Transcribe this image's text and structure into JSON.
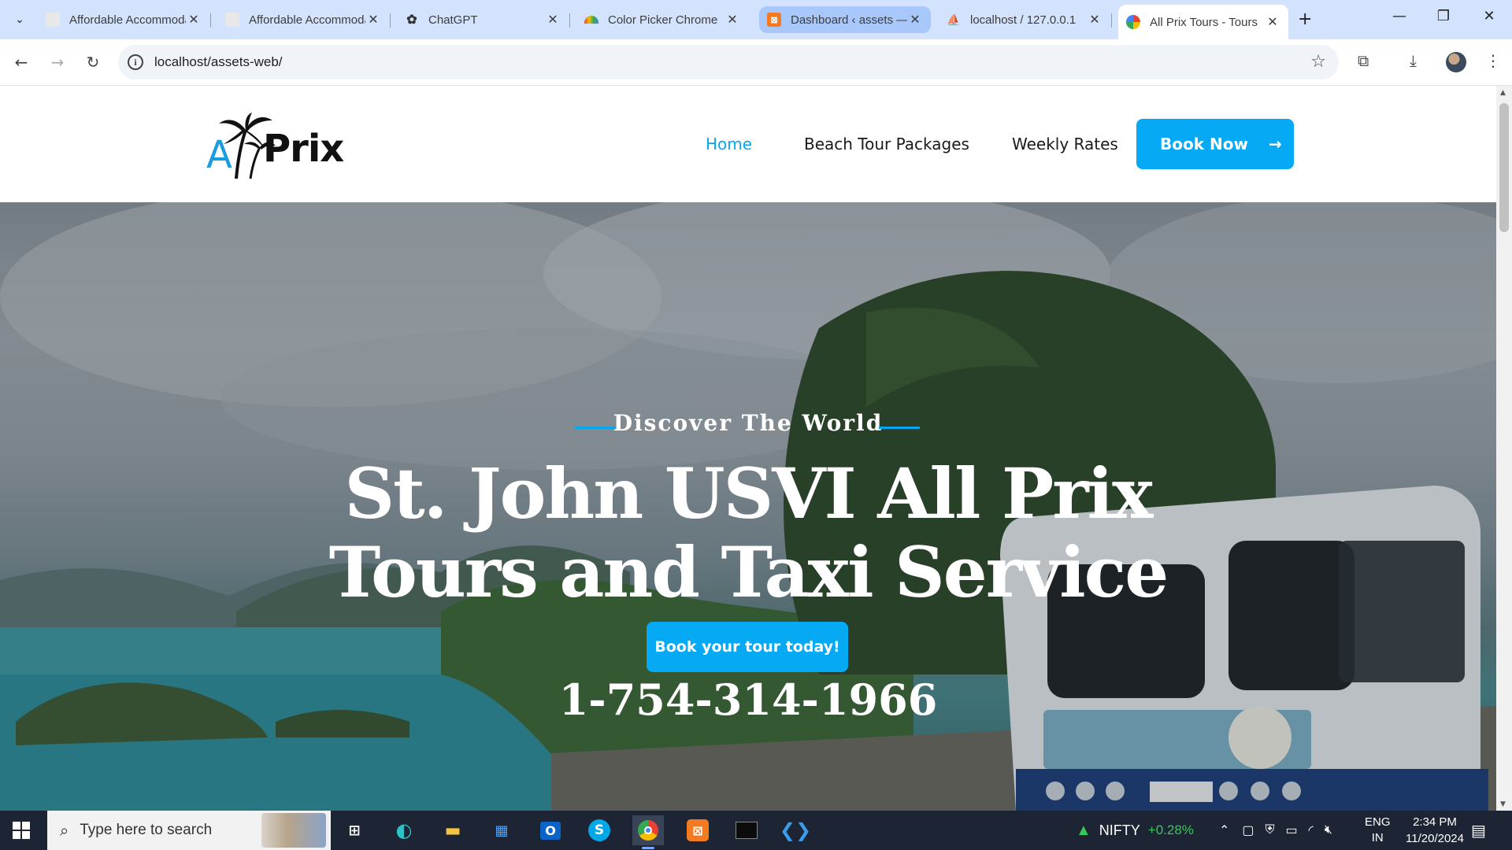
{
  "browser": {
    "tabs": [
      {
        "title": "Affordable Accommodation",
        "favicon": "page-thumbnail-icon"
      },
      {
        "title": "Affordable Accommodation",
        "favicon": "page-thumbnail-icon"
      },
      {
        "title": "ChatGPT",
        "favicon": "chatgpt-icon"
      },
      {
        "title": "Color Picker Chrome",
        "favicon": "rainbow-icon"
      },
      {
        "title": "Dashboard ‹ assets —",
        "favicon": "xampp-icon"
      },
      {
        "title": "localhost / 127.0.0.1",
        "favicon": "phpmyadmin-icon"
      },
      {
        "title": "All Prix Tours - Tours",
        "favicon": "site-favicon"
      }
    ],
    "new_tab": "+",
    "url": "localhost/assets-web/",
    "controls": {
      "minimize": "—",
      "restore": "❐",
      "close": "✕"
    }
  },
  "site": {
    "logo": {
      "letter": "A",
      "text": "Prix"
    },
    "nav": {
      "home": "Home",
      "packages": "Beach Tour Packages",
      "rates": "Weekly Rates",
      "book": "Book Now",
      "book_arrow": "→"
    },
    "hero": {
      "eyebrow": "Discover The World",
      "title_line1": "St. John USVI All Prix",
      "title_line2": "Tours and Taxi Service",
      "cta": "Book your tour today!",
      "phone": "1-754-314-1966"
    },
    "colors": {
      "accent": "#05a9f4",
      "nav_active": "#0aa5ef"
    }
  },
  "taskbar": {
    "search_placeholder": "Type here to search",
    "ticker": {
      "name": "NIFTY",
      "change": "+0.28%"
    },
    "lang_top": "ENG",
    "lang_bottom": "IN",
    "time": "2:34 PM",
    "date": "11/20/2024"
  }
}
